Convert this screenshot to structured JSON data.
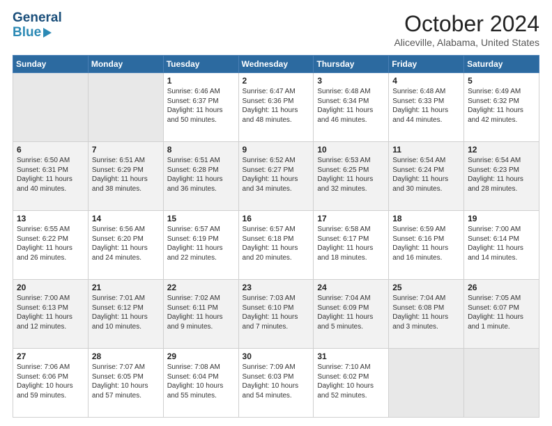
{
  "header": {
    "logo_line1": "General",
    "logo_line2": "Blue",
    "month": "October 2024",
    "location": "Aliceville, Alabama, United States"
  },
  "weekdays": [
    "Sunday",
    "Monday",
    "Tuesday",
    "Wednesday",
    "Thursday",
    "Friday",
    "Saturday"
  ],
  "weeks": [
    [
      {
        "day": "",
        "text": ""
      },
      {
        "day": "",
        "text": ""
      },
      {
        "day": "1",
        "text": "Sunrise: 6:46 AM\nSunset: 6:37 PM\nDaylight: 11 hours and 50 minutes."
      },
      {
        "day": "2",
        "text": "Sunrise: 6:47 AM\nSunset: 6:36 PM\nDaylight: 11 hours and 48 minutes."
      },
      {
        "day": "3",
        "text": "Sunrise: 6:48 AM\nSunset: 6:34 PM\nDaylight: 11 hours and 46 minutes."
      },
      {
        "day": "4",
        "text": "Sunrise: 6:48 AM\nSunset: 6:33 PM\nDaylight: 11 hours and 44 minutes."
      },
      {
        "day": "5",
        "text": "Sunrise: 6:49 AM\nSunset: 6:32 PM\nDaylight: 11 hours and 42 minutes."
      }
    ],
    [
      {
        "day": "6",
        "text": "Sunrise: 6:50 AM\nSunset: 6:31 PM\nDaylight: 11 hours and 40 minutes."
      },
      {
        "day": "7",
        "text": "Sunrise: 6:51 AM\nSunset: 6:29 PM\nDaylight: 11 hours and 38 minutes."
      },
      {
        "day": "8",
        "text": "Sunrise: 6:51 AM\nSunset: 6:28 PM\nDaylight: 11 hours and 36 minutes."
      },
      {
        "day": "9",
        "text": "Sunrise: 6:52 AM\nSunset: 6:27 PM\nDaylight: 11 hours and 34 minutes."
      },
      {
        "day": "10",
        "text": "Sunrise: 6:53 AM\nSunset: 6:25 PM\nDaylight: 11 hours and 32 minutes."
      },
      {
        "day": "11",
        "text": "Sunrise: 6:54 AM\nSunset: 6:24 PM\nDaylight: 11 hours and 30 minutes."
      },
      {
        "day": "12",
        "text": "Sunrise: 6:54 AM\nSunset: 6:23 PM\nDaylight: 11 hours and 28 minutes."
      }
    ],
    [
      {
        "day": "13",
        "text": "Sunrise: 6:55 AM\nSunset: 6:22 PM\nDaylight: 11 hours and 26 minutes."
      },
      {
        "day": "14",
        "text": "Sunrise: 6:56 AM\nSunset: 6:20 PM\nDaylight: 11 hours and 24 minutes."
      },
      {
        "day": "15",
        "text": "Sunrise: 6:57 AM\nSunset: 6:19 PM\nDaylight: 11 hours and 22 minutes."
      },
      {
        "day": "16",
        "text": "Sunrise: 6:57 AM\nSunset: 6:18 PM\nDaylight: 11 hours and 20 minutes."
      },
      {
        "day": "17",
        "text": "Sunrise: 6:58 AM\nSunset: 6:17 PM\nDaylight: 11 hours and 18 minutes."
      },
      {
        "day": "18",
        "text": "Sunrise: 6:59 AM\nSunset: 6:16 PM\nDaylight: 11 hours and 16 minutes."
      },
      {
        "day": "19",
        "text": "Sunrise: 7:00 AM\nSunset: 6:14 PM\nDaylight: 11 hours and 14 minutes."
      }
    ],
    [
      {
        "day": "20",
        "text": "Sunrise: 7:00 AM\nSunset: 6:13 PM\nDaylight: 11 hours and 12 minutes."
      },
      {
        "day": "21",
        "text": "Sunrise: 7:01 AM\nSunset: 6:12 PM\nDaylight: 11 hours and 10 minutes."
      },
      {
        "day": "22",
        "text": "Sunrise: 7:02 AM\nSunset: 6:11 PM\nDaylight: 11 hours and 9 minutes."
      },
      {
        "day": "23",
        "text": "Sunrise: 7:03 AM\nSunset: 6:10 PM\nDaylight: 11 hours and 7 minutes."
      },
      {
        "day": "24",
        "text": "Sunrise: 7:04 AM\nSunset: 6:09 PM\nDaylight: 11 hours and 5 minutes."
      },
      {
        "day": "25",
        "text": "Sunrise: 7:04 AM\nSunset: 6:08 PM\nDaylight: 11 hours and 3 minutes."
      },
      {
        "day": "26",
        "text": "Sunrise: 7:05 AM\nSunset: 6:07 PM\nDaylight: 11 hours and 1 minute."
      }
    ],
    [
      {
        "day": "27",
        "text": "Sunrise: 7:06 AM\nSunset: 6:06 PM\nDaylight: 10 hours and 59 minutes."
      },
      {
        "day": "28",
        "text": "Sunrise: 7:07 AM\nSunset: 6:05 PM\nDaylight: 10 hours and 57 minutes."
      },
      {
        "day": "29",
        "text": "Sunrise: 7:08 AM\nSunset: 6:04 PM\nDaylight: 10 hours and 55 minutes."
      },
      {
        "day": "30",
        "text": "Sunrise: 7:09 AM\nSunset: 6:03 PM\nDaylight: 10 hours and 54 minutes."
      },
      {
        "day": "31",
        "text": "Sunrise: 7:10 AM\nSunset: 6:02 PM\nDaylight: 10 hours and 52 minutes."
      },
      {
        "day": "",
        "text": ""
      },
      {
        "day": "",
        "text": ""
      }
    ]
  ]
}
